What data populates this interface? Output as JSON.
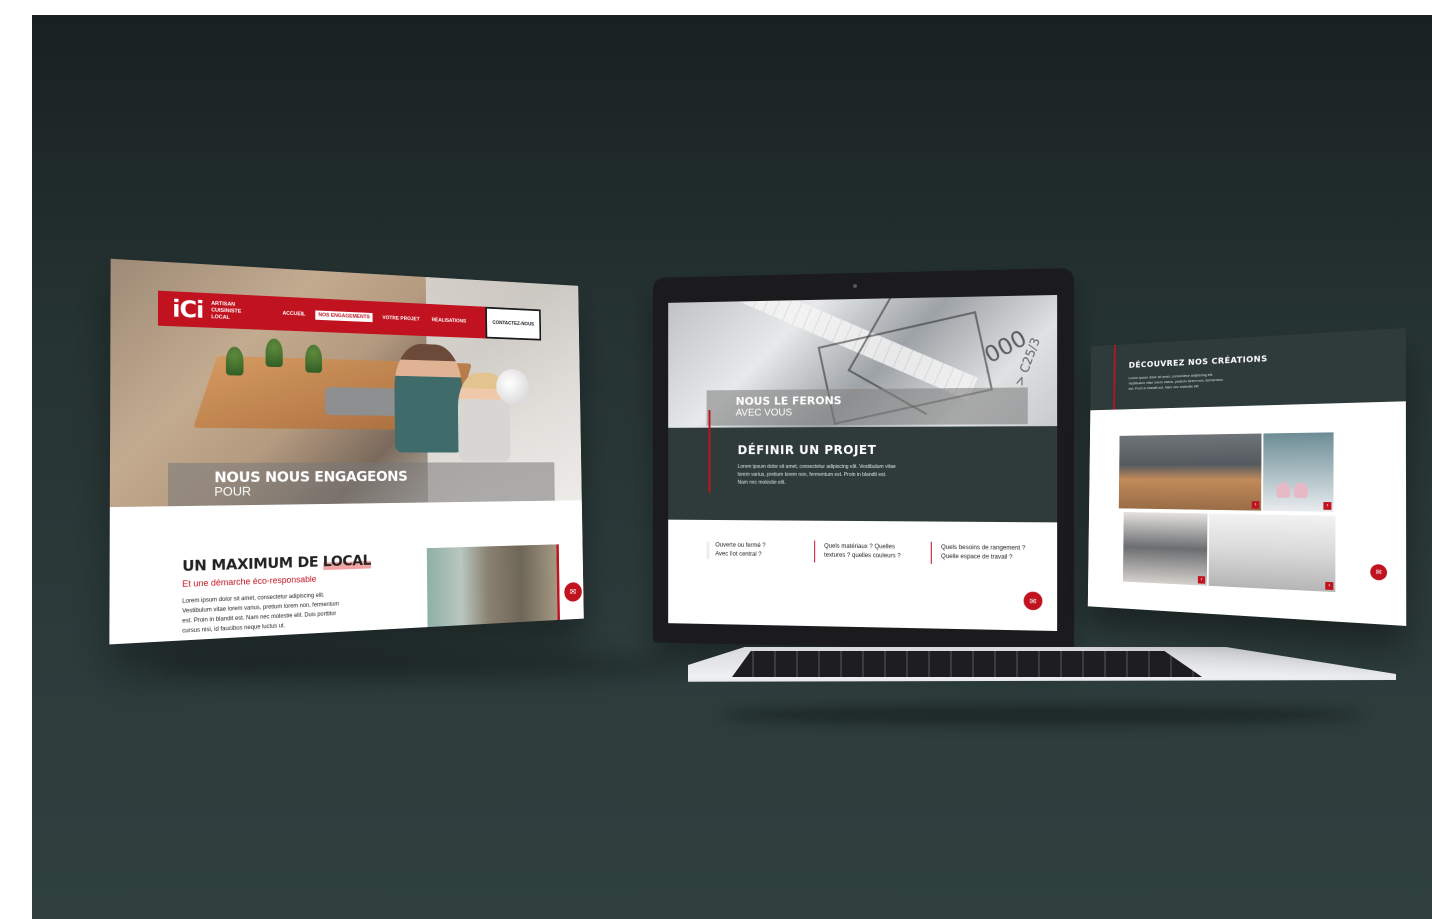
{
  "colors": {
    "brand_red": "#c1121f",
    "dark_green": "#2e3b3a",
    "background_top": "#182120",
    "background_bottom": "#2f403f"
  },
  "left_site": {
    "logo": "iCi",
    "tagline": [
      "ARTISAN",
      "CUISINISTE",
      "LOCAL"
    ],
    "nav": [
      {
        "label": "ACCUEIL",
        "active": false
      },
      {
        "label": "NOS ENGAGEMENTS",
        "active": true
      },
      {
        "label": "VOTRE PROJET",
        "active": false
      },
      {
        "label": "RÉALISATIONS",
        "active": false
      }
    ],
    "contact_label": "CONTACTEZ-NOUS",
    "hero_title": "NOUS NOUS ENGAGEONS",
    "hero_subtitle": "POUR",
    "section_title_main": "UN MAXIMUM DE ",
    "section_title_highlight": "LOCAL",
    "section_subtitle": "Et une démarche éco-responsable",
    "paragraph": "Lorem ipsum dolor sit amet, consectetur adipiscing elit. Vestibulum vitae lorem varius, pretium lorem non, fermentum est. Proin in blandit est. Nam nec molestie elit. Duis porttitor cursus nisi, id faucibus neque luctus ut.",
    "fab_icon": "mail-icon"
  },
  "laptop_site": {
    "hero_title": "NOUS LE FERONS",
    "hero_subtitle": "AVEC VOUS",
    "drawing_text_1": "000",
    "drawing_text_2": "> C25/3",
    "section_title": "DÉFINIR UN PROJET",
    "paragraph": "Lorem ipsum dolor sit amet, consectetur adipiscing elit. Vestibulum vitae lorem varius, pretium lorem non, fermentum est. Proin in blandit est. Nam nec molestie elit.",
    "questions": [
      {
        "line1": "Ouverte ou fermé ?",
        "line2": "Avec îlot central ?"
      },
      {
        "line1": "Quels matériaux ? Quelles",
        "line2": "textures ? quelles couleurs ?"
      },
      {
        "line1": "Quels besoins de rangement ?",
        "line2": "Quelle espace de travail ?"
      }
    ],
    "fab_icon": "mail-icon"
  },
  "right_site": {
    "section_title": "DÉCOUVREZ NOS CRÉATIONS",
    "paragraph": "Lorem ipsum dolor sit amet, consectetur adipiscing elit. Vestibulum vitae lorem varius, pretium lorem non, fermentum est. Proin in blandit est. Nam nec molestie elit.",
    "tile_arrow": "›",
    "fab_icon": "mail-icon"
  }
}
